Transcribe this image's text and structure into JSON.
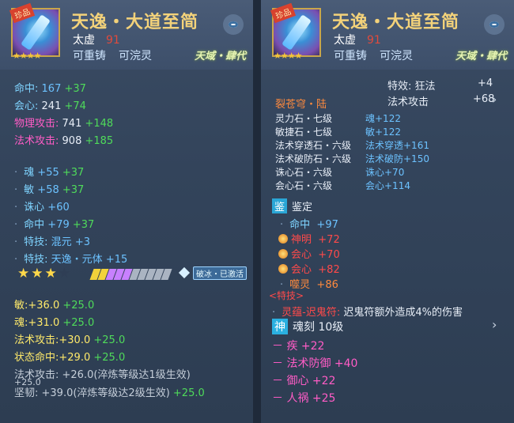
{
  "left": {
    "badge": "珍品",
    "stars": "★★★★",
    "title": "天逸・大道至简",
    "owner": "太虚",
    "level": "91",
    "actions": [
      "可重铸",
      "可浣灵"
    ],
    "era": "天域・肆代",
    "stats": [
      {
        "label": "命中:",
        "value": "167",
        "bonus": "+37"
      },
      {
        "label": "会心:",
        "value": "241",
        "bonus": "+74"
      },
      {
        "label": "物理攻击:",
        "value": "741",
        "bonus": "+148"
      },
      {
        "label": "法术攻击:",
        "value": "908",
        "bonus": "+185"
      }
    ],
    "attrs": [
      {
        "label": "魂",
        "value": "+55",
        "bonus": "+37"
      },
      {
        "label": "敏",
        "value": "+58",
        "bonus": "+37"
      },
      {
        "label": "诛心",
        "value": "+60",
        "bonus": ""
      },
      {
        "label": "命中",
        "value": "+79",
        "bonus": "+37"
      },
      {
        "label": "特技:",
        "value": "混元",
        "bonus": "+3"
      },
      {
        "label": "特技:",
        "value": "天逸・元体",
        "bonus": "+15"
      }
    ],
    "activated": "破冰・已激活",
    "refine": [
      {
        "label": "敏:",
        "value": "+36.0",
        "bonus": "+25.0"
      },
      {
        "label": "魂:",
        "value": "+31.0",
        "bonus": "+25.0"
      },
      {
        "label": "法术攻击:",
        "value": "+30.0",
        "bonus": "+25.0"
      },
      {
        "label": "状态命中:",
        "value": "+29.0",
        "bonus": "+25.0"
      }
    ],
    "refine_locked": [
      {
        "text": "法术攻击: +26.0(淬炼等级达1级生效)",
        "bonus": "+25.0"
      },
      {
        "text": "坚韧: +39.0(淬炼等级达2级生效)",
        "bonus": "+25.0"
      }
    ]
  },
  "right": {
    "badge": "珍品",
    "stars": "★★★★",
    "title": "天逸・大道至简",
    "owner": "太虚",
    "level": "91",
    "actions": [
      "可重铸",
      "可浣灵"
    ],
    "era": "天域・肆代",
    "effects": [
      {
        "label": "特效: 狂法",
        "value": "+4"
      },
      {
        "label": "法术攻击",
        "value": "+68"
      }
    ],
    "gem_title": "裂苍穹・陆",
    "gems": [
      {
        "name": "灵力石・七级",
        "stat": "魂+122"
      },
      {
        "name": "敏捷石・七级",
        "stat": "敏+122"
      },
      {
        "name": "法术穿透石・六级",
        "stat": "法术穿透+161"
      },
      {
        "name": "法术破防石・六级",
        "stat": "法术破防+150"
      },
      {
        "name": "诛心石・六级",
        "stat": "诛心+70"
      },
      {
        "name": "会心石・六级",
        "stat": "会心+114"
      }
    ],
    "appraise_seal": "鉴",
    "appraise_label": "鉴定",
    "appraise": [
      {
        "label": "命中",
        "value": "+97",
        "color": "#7fd4ff",
        "ornament": false
      },
      {
        "label": "神明",
        "value": "+72",
        "color": "#ff6a3c",
        "ornament": true
      },
      {
        "label": "会心",
        "value": "+70",
        "color": "#ff6a3c",
        "ornament": true
      },
      {
        "label": "会心",
        "value": "+82",
        "color": "#ff6a3c",
        "ornament": true
      },
      {
        "label": "噬灵",
        "value": "+86",
        "color": "#ffa040",
        "ornament": false
      }
    ],
    "special_tag": "<特技>",
    "special_name": "灵蕴-迟鬼符:",
    "special_desc": "迟鬼符额外造成4%的伤害",
    "soul_seal": "神",
    "soul_label": "魂刻 10级",
    "soul": [
      {
        "label": "疾",
        "value": "+22"
      },
      {
        "label": "法术防御",
        "value": "+40"
      },
      {
        "label": "御心",
        "value": "+22"
      },
      {
        "label": "人祸",
        "value": "+25"
      }
    ]
  },
  "colors": {
    "gold_title": "#f3d27a",
    "green": "#4fdb5a",
    "pink": "#ff5cc6",
    "cyan": "#7fd4ff"
  }
}
